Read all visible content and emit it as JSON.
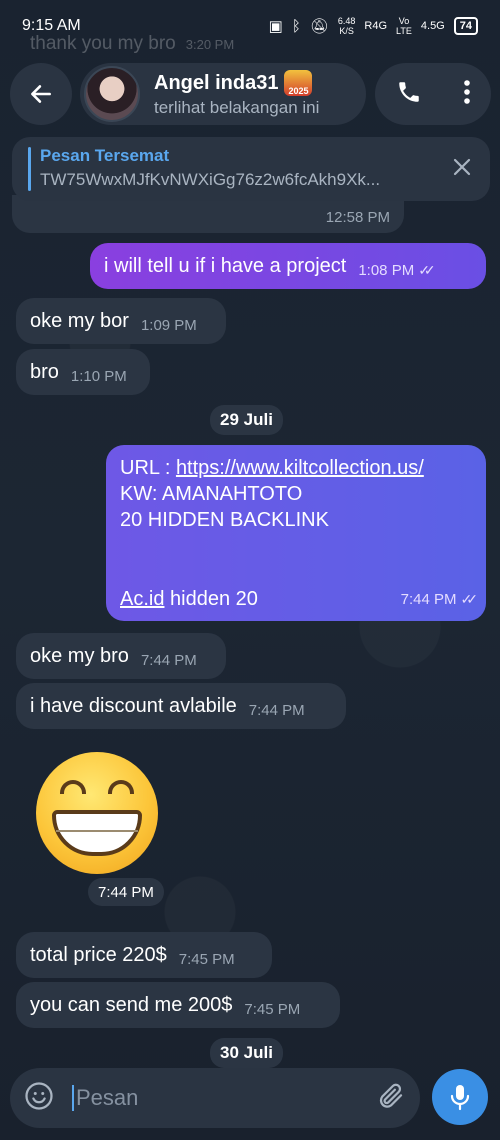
{
  "status": {
    "time": "9:15 AM",
    "speed": "6.48",
    "speed_unit": "K/S",
    "net1": "R4G",
    "net2_top": "Vo",
    "net2_bottom": "LTE",
    "net3": "4.5G",
    "battery": "74"
  },
  "faded_prev": {
    "text": "thank you my bro",
    "time": "3:20 PM"
  },
  "header": {
    "name": "Angel inda31",
    "badge": "2025",
    "status": "terlihat belakangan ini"
  },
  "pinned": {
    "title": "Pesan Tersemat",
    "text": "TW75WwxMJfKvNWXiGg76z2w6fcAkh9Xk..."
  },
  "messages": {
    "m0_time": "12:58 PM",
    "m1_text": "i will tell u if i have a project",
    "m1_time": "1:08 PM",
    "m2_text": "oke my bor",
    "m2_time": "1:09 PM",
    "m3_text": "bro",
    "m3_time": "1:10 PM",
    "date1": "29 Juli",
    "m4_url_label": "URL : ",
    "m4_url": "https://www.kiltcollection.us/",
    "m4_kw": "KW: AMANAHTOTO",
    "m4_line3": "20 HIDDEN BACKLINK",
    "m4_link": "Ac.id",
    "m4_tail": " hidden 20",
    "m4_time": "7:44 PM",
    "m5_text": "oke my bro",
    "m5_time": "7:44 PM",
    "m6_text": "i have discount avlabile",
    "m6_time": "7:44 PM",
    "emoji_time": "7:44 PM",
    "m7_text": "total price 220$",
    "m7_time": "7:45 PM",
    "m8_text": "you can send me 200$",
    "m8_time": "7:45 PM",
    "date2": "30 Juli"
  },
  "input": {
    "placeholder": "Pesan"
  }
}
